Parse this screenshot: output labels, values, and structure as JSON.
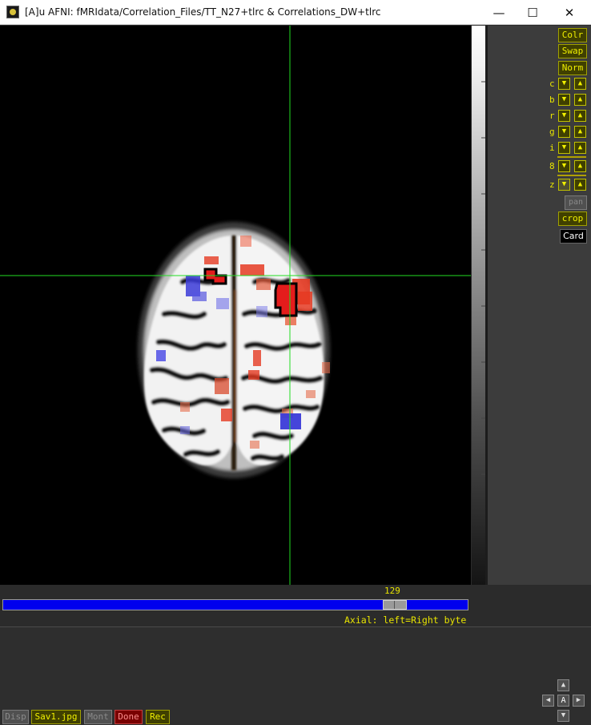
{
  "window": {
    "title": "[A]u AFNI: fMRIdata/Correlation_Files/TT_N27+tlrc & Correlations_DW+tlrc",
    "minimize": "—",
    "maximize": "☐",
    "close": "✕"
  },
  "colors": {
    "overlay_pos": "#e53a22",
    "overlay_neg": "#3b3bd8",
    "crosshair": "#22dd22",
    "slider": "#0000ee"
  },
  "side_controls": {
    "colr": "Colr",
    "swap": "Swap",
    "norm": "Norm",
    "rows": [
      {
        "label": "c"
      },
      {
        "label": "b"
      },
      {
        "label": "r"
      },
      {
        "label": "g"
      },
      {
        "label": "i"
      },
      {
        "label": "8"
      },
      {
        "label": "z"
      }
    ],
    "pan": "pan",
    "crop": "crop",
    "card": "Card"
  },
  "slider": {
    "value": "129",
    "fraction": 0.835
  },
  "orientation_label": "Axial: left=Right byte",
  "bottom_buttons": {
    "disp": "Disp",
    "save": "Sav1.jpg",
    "mont": "Mont",
    "done": "Done",
    "rec": "Rec"
  },
  "nav": {
    "center": "A"
  }
}
